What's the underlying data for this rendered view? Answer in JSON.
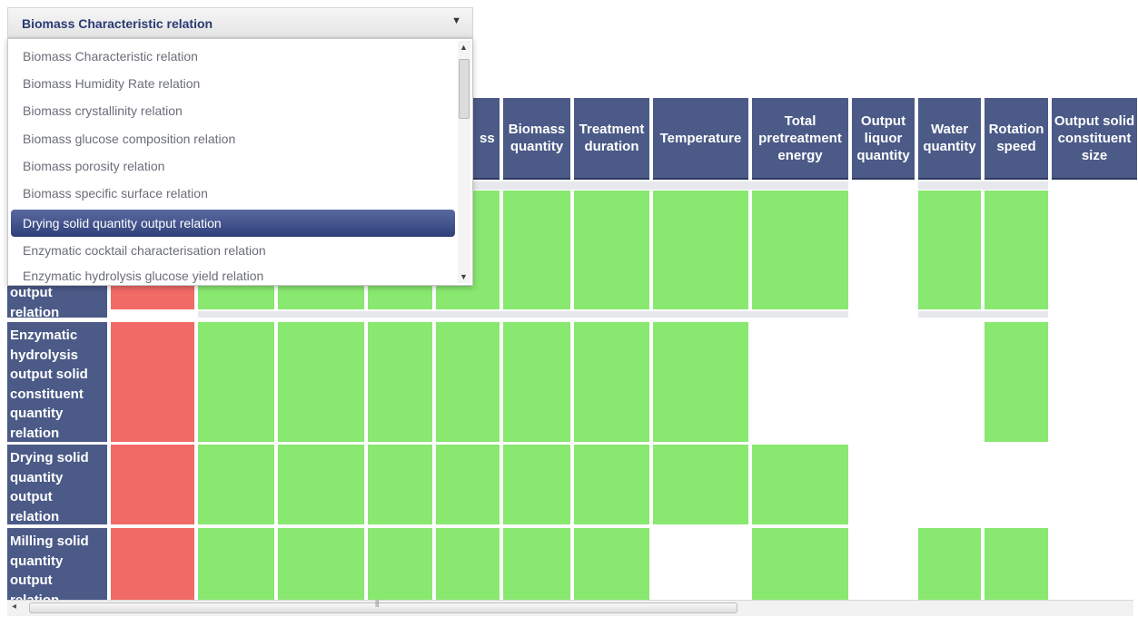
{
  "columns": [
    {
      "id": "biomass-mass",
      "label": "ss"
    },
    {
      "id": "biomass-quantity",
      "label": "Biomass quantity"
    },
    {
      "id": "treatment-duration",
      "label": "Treatment duration"
    },
    {
      "id": "temperature",
      "label": "Temperature"
    },
    {
      "id": "total-pretreatment-energy",
      "label": "Total pretreatment energy"
    },
    {
      "id": "output-liquor-quantity",
      "label": "Output liquor quantity"
    },
    {
      "id": "water-quantity",
      "label": "Water quantity"
    },
    {
      "id": "rotation-speed",
      "label": "Rotation speed"
    },
    {
      "id": "output-solid-constituent-size",
      "label": "Output solid constituent size"
    }
  ],
  "rows": [
    {
      "label": "output relation"
    },
    {
      "label": "Enzymatic hydrolysis output solid constituent quantity relation"
    },
    {
      "label": "Drying solid quantity output relation"
    },
    {
      "label": "Milling solid quantity output relation"
    }
  ],
  "dropdown": {
    "selected": "Biomass Characteristic relation",
    "options": [
      "Biomass Characteristic relation",
      "Biomass Humidity Rate relation",
      "Biomass crystallinity relation",
      "Biomass glucose composition relation",
      "Biomass porosity relation",
      "Biomass specific surface relation",
      "Drying solid quantity output relation",
      "Enzymatic cocktail characterisation relation",
      "Enzymatic hydrolysis glucose yield relation"
    ],
    "highlighted_index": 6
  },
  "colors": {
    "header_bg": "#4b5a87",
    "cell_green": "#88e86f",
    "cell_red": "#f26a66",
    "selected_item": "#3b4a83"
  },
  "icons": {
    "dropdown_arrow": "triangle-down",
    "scroll_up": "triangle-up",
    "scroll_down": "triangle-down",
    "scroll_left": "triangle-left",
    "grip": "grip-lines"
  }
}
